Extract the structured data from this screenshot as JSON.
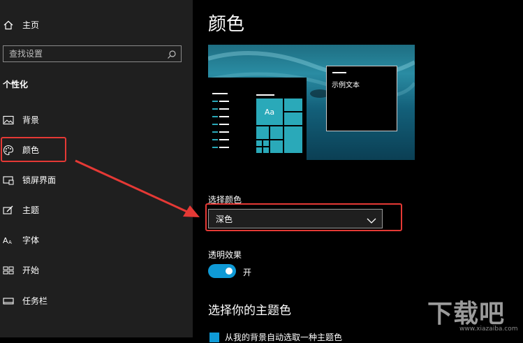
{
  "sidebar": {
    "home_label": "主页",
    "search_placeholder": "查找设置",
    "section_title": "个性化",
    "items": [
      {
        "label": "背景",
        "icon": "picture-icon"
      },
      {
        "label": "颜色",
        "icon": "palette-icon"
      },
      {
        "label": "锁屏界面",
        "icon": "lock-screen-icon"
      },
      {
        "label": "主题",
        "icon": "theme-brush-icon"
      },
      {
        "label": "字体",
        "icon": "font-icon"
      },
      {
        "label": "开始",
        "icon": "start-tiles-icon"
      },
      {
        "label": "任务栏",
        "icon": "taskbar-icon"
      }
    ]
  },
  "main": {
    "title": "颜色",
    "preview": {
      "sample_text": "示例文本",
      "tile_label": "Aa"
    },
    "choose_color": {
      "label": "选择颜色",
      "value": "深色"
    },
    "transparency": {
      "label": "透明效果",
      "state_label": "开",
      "on": true
    },
    "accent": {
      "title": "选择你的主题色",
      "auto_pick_label": "从我的背景自动选取一种主题色"
    }
  },
  "colors": {
    "accent": "#0f9ad6",
    "sidebar_bg": "#1f1f1f",
    "highlight": "#e53935",
    "preview_teal": "#2aa9b9"
  },
  "watermark": {
    "text": "下载吧",
    "url": "www.xiazaiba.com"
  }
}
